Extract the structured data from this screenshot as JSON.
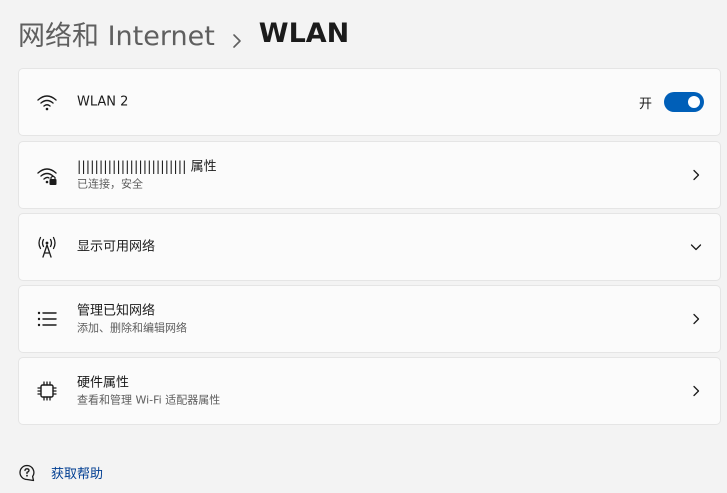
{
  "breadcrumb": {
    "parent": "网络和 Internet",
    "separator_icon": "chevron-right-icon",
    "current": "WLAN"
  },
  "rows": [
    {
      "icon": "wifi-icon",
      "title": "WLAN 2",
      "toggle": {
        "label": "开",
        "state": true,
        "color": "#005fb8"
      }
    },
    {
      "icon": "wifi-lock-icon",
      "title": "||||||||||||||||||||||||| 属性",
      "subtitle": "已连接，安全",
      "action_icon": "chevron-right-icon"
    },
    {
      "icon": "antenna-icon",
      "title": "显示可用网络",
      "action_icon": "chevron-down-icon"
    },
    {
      "icon": "list-icon",
      "title": "管理已知网络",
      "subtitle": "添加、删除和编辑网络",
      "action_icon": "chevron-right-icon"
    },
    {
      "icon": "chip-icon",
      "title": "硬件属性",
      "subtitle": "查看和管理 Wi-Fi 适配器属性",
      "action_icon": "chevron-right-icon"
    }
  ],
  "help": {
    "icon": "help-chat-icon",
    "label": "获取帮助",
    "color": "#003e92"
  }
}
